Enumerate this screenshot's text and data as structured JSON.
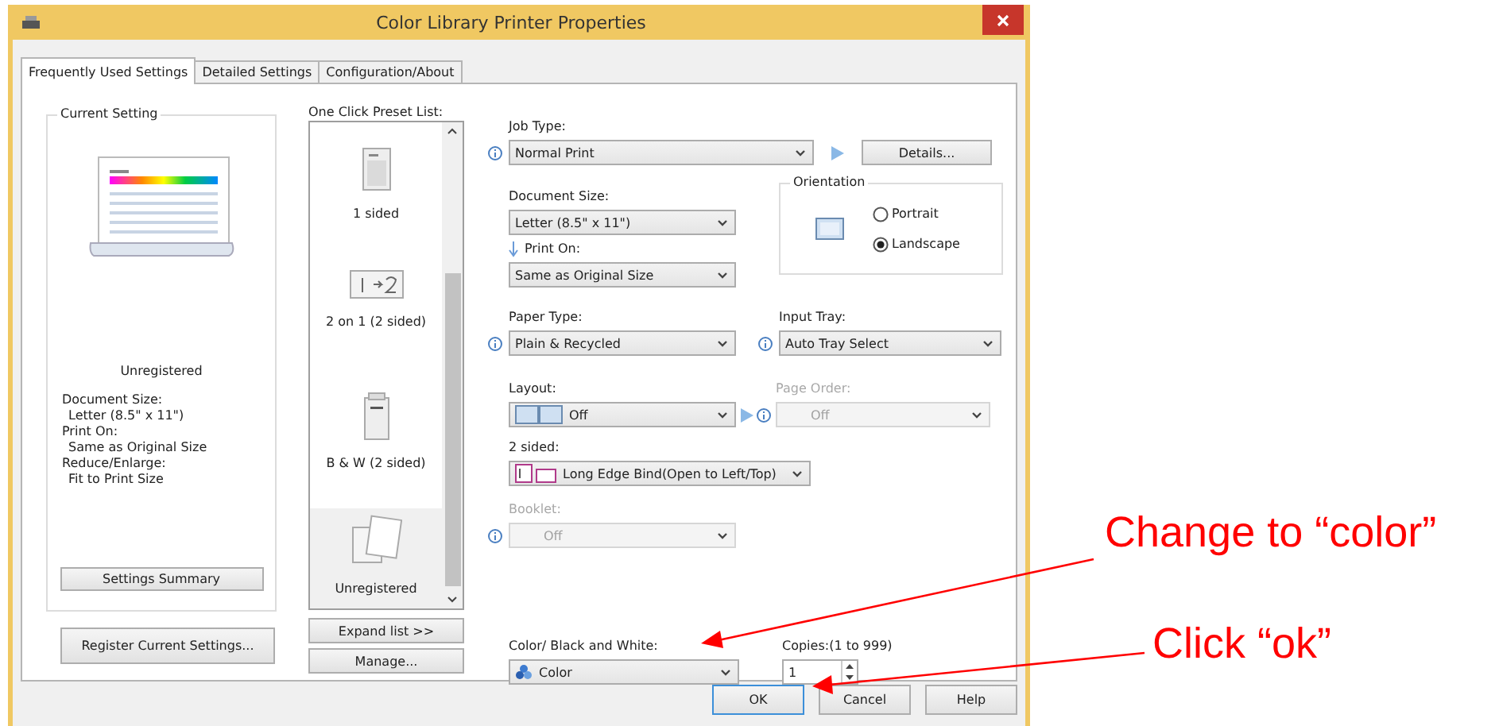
{
  "window": {
    "title": "Color Library Printer Properties"
  },
  "tabs": [
    {
      "label": "Frequently Used Settings",
      "selected": true
    },
    {
      "label": "Detailed Settings",
      "selected": false
    },
    {
      "label": "Configuration/About",
      "selected": false
    }
  ],
  "current_setting": {
    "title": "Current Setting",
    "preset_name": "Unregistered",
    "summary": [
      {
        "label": "Document Size:",
        "value": "Letter (8.5\" x 11\")"
      },
      {
        "label": "Print On:",
        "value": "Same as Original Size"
      },
      {
        "label": "Reduce/Enlarge:",
        "value": "Fit to Print Size"
      }
    ],
    "summary_button": "Settings Summary"
  },
  "register_button": "Register Current Settings...",
  "preset_list": {
    "label": "One Click Preset List:",
    "items": [
      {
        "label": "1 sided",
        "kind": "page",
        "selected": false
      },
      {
        "label": "2 on 1 (2 sided)",
        "kind": "two-on-one",
        "selected": false
      },
      {
        "label": "B & W (2 sided)",
        "kind": "bw",
        "selected": false
      },
      {
        "label": "Unregistered",
        "kind": "blank",
        "selected": true
      }
    ],
    "expand_button": "Expand list >>",
    "manage_button": "Manage..."
  },
  "job_type": {
    "label": "Job Type:",
    "value": "Normal Print",
    "details_button": "Details..."
  },
  "document_size": {
    "label": "Document Size:",
    "value": "Letter (8.5\" x 11\")"
  },
  "print_on": {
    "label": "Print On:",
    "value": "Same as Original Size"
  },
  "orientation": {
    "title": "Orientation",
    "options": [
      {
        "label": "Portrait",
        "selected": false
      },
      {
        "label": "Landscape",
        "selected": true
      }
    ]
  },
  "paper_type": {
    "label": "Paper Type:",
    "value": "Plain & Recycled"
  },
  "input_tray": {
    "label": "Input Tray:",
    "value": "Auto Tray Select"
  },
  "layout": {
    "label": "Layout:",
    "value": "Off"
  },
  "page_order": {
    "label": "Page Order:",
    "value": "Off",
    "disabled": true
  },
  "two_sided": {
    "label": "2 sided:",
    "value": "Long Edge Bind(Open to Left/Top)"
  },
  "booklet": {
    "label": "Booklet:",
    "value": "Off",
    "disabled": true
  },
  "color_bw": {
    "label": "Color/ Black and White:",
    "value": "Color"
  },
  "copies": {
    "label": "Copies:(1 to 999)",
    "value": "1"
  },
  "buttons": [
    {
      "label": "OK",
      "selected": true
    },
    {
      "label": "Cancel",
      "selected": false
    },
    {
      "label": "Help",
      "selected": false
    }
  ],
  "annotations": [
    {
      "text": "Change to “color”"
    },
    {
      "text": "Click “ok”"
    }
  ]
}
